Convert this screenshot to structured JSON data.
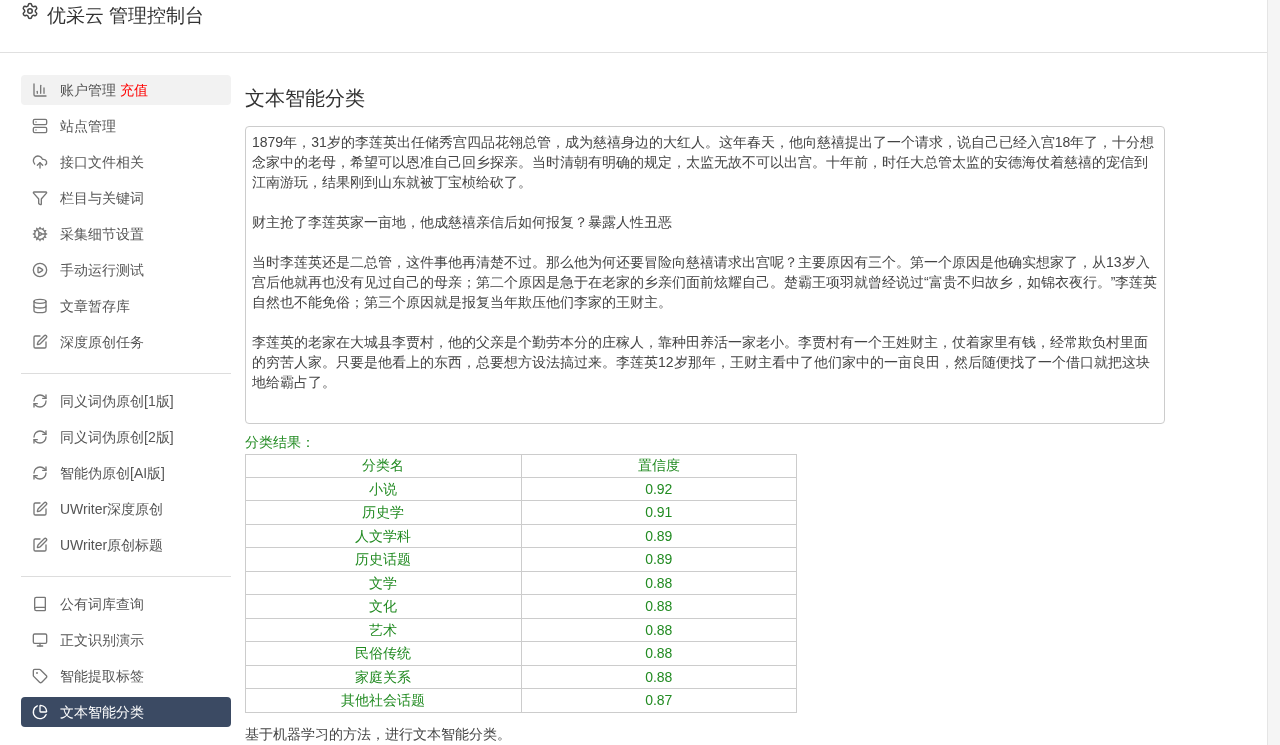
{
  "header": {
    "title": "优采云 管理控制台"
  },
  "sidebar": {
    "groups": [
      {
        "items": [
          {
            "label": "账户管理",
            "badge": "充值",
            "highlighted": true,
            "selected": false
          },
          {
            "label": "站点管理",
            "highlighted": false,
            "selected": false
          },
          {
            "label": "接口文件相关",
            "highlighted": false,
            "selected": false
          },
          {
            "label": "栏目与关键词",
            "highlighted": false,
            "selected": false
          },
          {
            "label": "采集细节设置",
            "highlighted": false,
            "selected": false
          },
          {
            "label": "手动运行测试",
            "highlighted": false,
            "selected": false
          },
          {
            "label": "文章暂存库",
            "highlighted": false,
            "selected": false
          },
          {
            "label": "深度原创任务",
            "highlighted": false,
            "selected": false
          }
        ]
      },
      {
        "items": [
          {
            "label": "同义词伪原创[1版]",
            "highlighted": false,
            "selected": false
          },
          {
            "label": "同义词伪原创[2版]",
            "highlighted": false,
            "selected": false
          },
          {
            "label": "智能伪原创[AI版]",
            "highlighted": false,
            "selected": false
          },
          {
            "label": "UWriter深度原创",
            "highlighted": false,
            "selected": false
          },
          {
            "label": "UWriter原创标题",
            "highlighted": false,
            "selected": false
          }
        ]
      },
      {
        "items": [
          {
            "label": "公有词库查询",
            "highlighted": false,
            "selected": false
          },
          {
            "label": "正文识别演示",
            "highlighted": false,
            "selected": false
          },
          {
            "label": "智能提取标签",
            "highlighted": false,
            "selected": false
          },
          {
            "label": "文本智能分类",
            "highlighted": false,
            "selected": true
          }
        ]
      }
    ]
  },
  "main": {
    "title": "文本智能分类",
    "text_input": {
      "paragraphs": [
        "1879年，31岁的李莲英出任储秀宫四品花翎总管，成为慈禧身边的大红人。这年春天，他向慈禧提出了一个请求，说自己已经入宫18年了，十分想念家中的老母，希望可以恩准自己回乡探亲。当时清朝有明确的规定，太监无故不可以出宫。十年前，时任大总管太监的安德海仗着慈禧的宠信到江南游玩，结果刚到山东就被丁宝桢给砍了。",
        "财主抢了李莲英家一亩地，他成慈禧亲信后如何报复？暴露人性丑恶",
        "当时李莲英还是二总管，这件事他再清楚不过。那么他为何还要冒险向慈禧请求出宫呢？主要原因有三个。第一个原因是他确实想家了，从13岁入宫后他就再也没有见过自己的母亲；第二个原因是急于在老家的乡亲们面前炫耀自己。楚霸王项羽就曾经说过“富贵不归故乡，如锦衣夜行。”李莲英自然也不能免俗；第三个原因就是报复当年欺压他们李家的王财主。",
        "李莲英的老家在大城县李贾村，他的父亲是个勤劳本分的庄稼人，靠种田养活一家老小。李贾村有一个王姓财主，仗着家里有钱，经常欺负村里面的穷苦人家。只要是他看上的东西，总要想方设法搞过来。李莲英12岁那年，王财主看中了他们家中的一亩良田，然后随便找了一个借口就把这块地给霸占了。"
      ]
    },
    "result_label": "分类结果：",
    "table": {
      "columns": [
        "分类名",
        "置信度"
      ],
      "rows": [
        [
          "小说",
          "0.92"
        ],
        [
          "历史学",
          "0.91"
        ],
        [
          "人文学科",
          "0.89"
        ],
        [
          "历史话题",
          "0.89"
        ],
        [
          "文学",
          "0.88"
        ],
        [
          "文化",
          "0.88"
        ],
        [
          "艺术",
          "0.88"
        ],
        [
          "民俗传统",
          "0.88"
        ],
        [
          "家庭关系",
          "0.88"
        ],
        [
          "其他社会话题",
          "0.87"
        ]
      ]
    },
    "footnote": "基于机器学习的方法，进行文本智能分类。"
  }
}
